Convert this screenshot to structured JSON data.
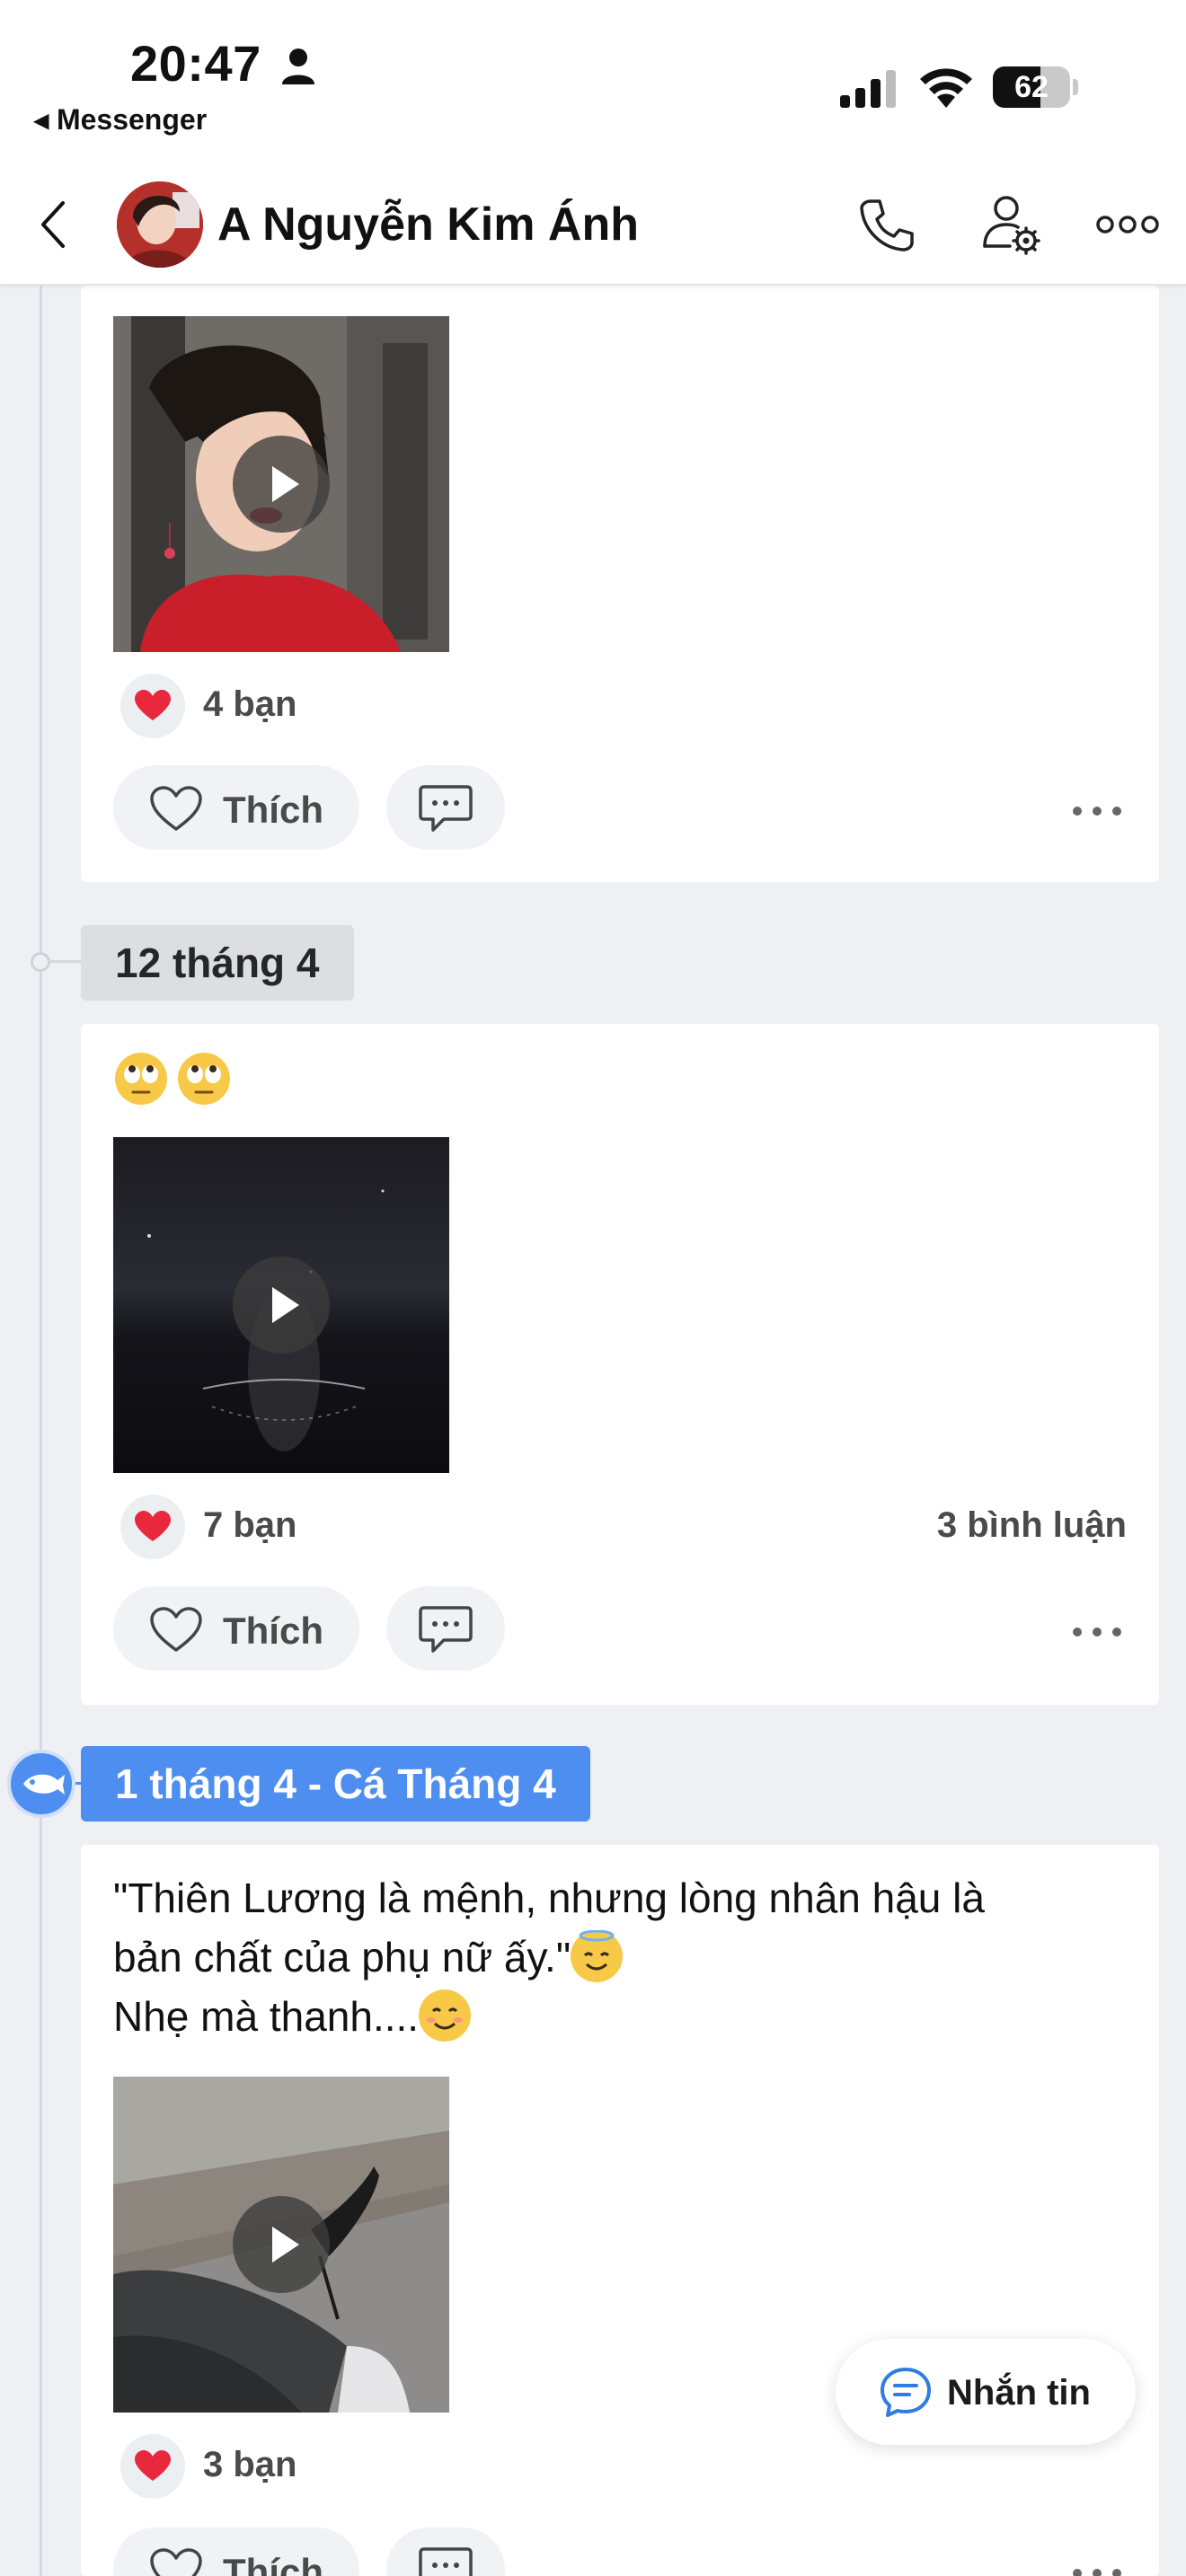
{
  "status_bar": {
    "time": "20:47",
    "back_app": "◂ Messenger",
    "battery": "62",
    "battery_level": 0.62
  },
  "header": {
    "name": "A Nguyễn Kim Ánh",
    "icons": [
      "back-chevron-icon",
      "phone-icon",
      "user-settings-icon",
      "more-icon"
    ]
  },
  "posts": [
    {
      "reactions": "4 bạn",
      "comments": "",
      "like_label": "Thích"
    },
    {
      "date": "12 tháng 4",
      "emoji_text": "🙄🙄",
      "reactions": "7 bạn",
      "comments": "3 bình luận",
      "like_label": "Thích"
    },
    {
      "date": "1 tháng 4 - Cá Tháng 4",
      "text_line1": "\"Thiên Lương là mệnh, nhưng lòng nhân hậu là",
      "text_line2": "bản chất của phụ nữ ấy.\"",
      "text_line3": "Nhẹ mà thanh....",
      "reactions": "3 bạn",
      "like_label": "Thích"
    }
  ],
  "fab": {
    "label": "Nhắn tin"
  },
  "colors": {
    "accent": "#4d8ef0",
    "heart": "#e8283c",
    "background": "#eef0f4"
  }
}
